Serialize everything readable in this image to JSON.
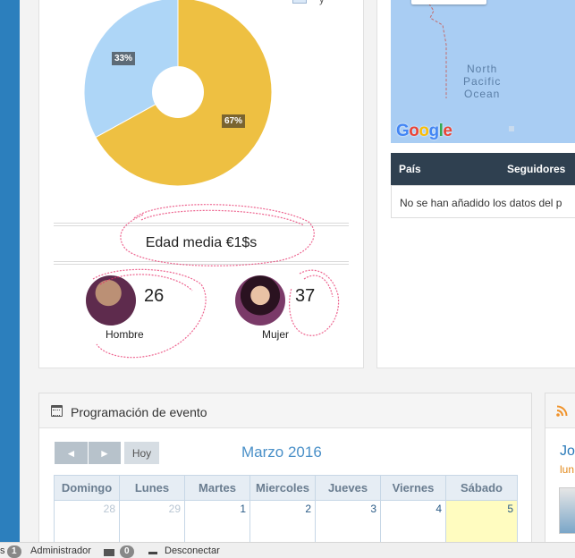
{
  "demographics": {
    "pie": [
      {
        "label": "33%",
        "value": 33,
        "color": "#aed6f7"
      },
      {
        "label": "67%",
        "value": 67,
        "color": "#eec042"
      }
    ],
    "legend_text": "y",
    "age_text": "Edad media €1$s",
    "male": {
      "count": "26",
      "label": "Hombre"
    },
    "female": {
      "count": "37",
      "label": "Mujer"
    }
  },
  "map": {
    "ocean_label_line1": "North",
    "ocean_label_line2": "Pacific",
    "ocean_label_line3": "Ocean",
    "logo": "Google"
  },
  "followers_table": {
    "headers": [
      "País",
      "Seguidores"
    ],
    "empty_text": "No se han añadido los datos del p"
  },
  "calendar": {
    "title": "Programación de evento",
    "prev_label": "◄",
    "next_label": "►",
    "today_label": "Hoy",
    "month_label": "Marzo 2016",
    "weekdays": [
      "Domingo",
      "Lunes",
      "Martes",
      "Miercoles",
      "Jueves",
      "Viernes",
      "Sábado"
    ],
    "days": [
      "28",
      "29",
      "1",
      "2",
      "3",
      "4",
      "5"
    ]
  },
  "side_panel": {
    "link_text": "Jo",
    "sub_text": "lun"
  },
  "bottom_bar": {
    "prefix": "s",
    "user_count": "1",
    "user_label": "Administrador",
    "mail_count": "0",
    "logout_label": "Desconectar"
  },
  "colors": {
    "sidebar": "#2c7fbd",
    "table_header": "#2f4050",
    "month_text": "#4a90c8",
    "today_cell": "#fffcc0",
    "annotation": "#e8326b"
  }
}
